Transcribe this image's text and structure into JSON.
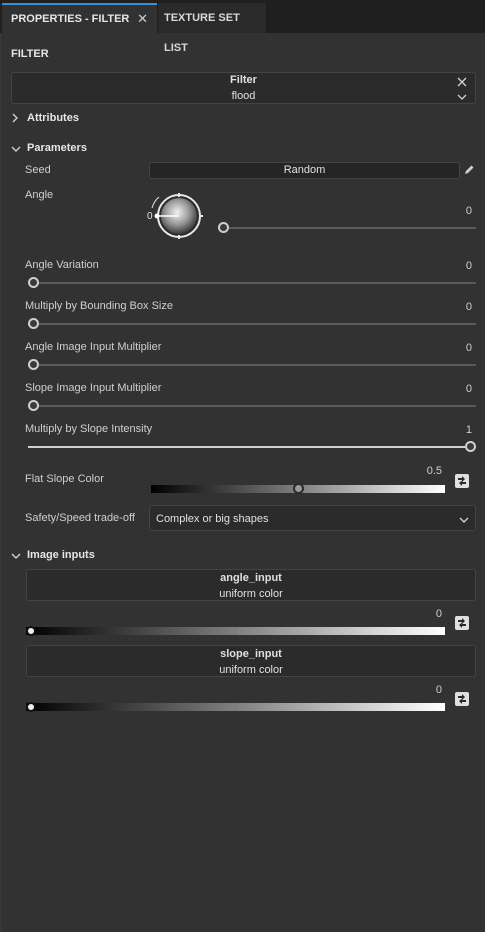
{
  "tabs": {
    "properties_label": "PROPERTIES - FILTER",
    "properties_close": "✕",
    "texture_set_label": "TEXTURE SET LIST"
  },
  "panel": {
    "section_title": "FILTER",
    "filter_header": "Filter",
    "filter_value": "flood"
  },
  "groups": {
    "attributes": "Attributes",
    "parameters": "Parameters",
    "image_inputs": "Image inputs"
  },
  "params": {
    "seed_label": "Seed",
    "seed_button": "Random",
    "angle_label": "Angle",
    "angle_dial_value": "0",
    "angle_value": "0",
    "angle_variation_label": "Angle Variation",
    "angle_variation_value": "0",
    "multiply_bbox_label": "Multiply by Bounding Box Size",
    "multiply_bbox_value": "0",
    "angle_image_mult_label": "Angle Image Input Multiplier",
    "angle_image_mult_value": "0",
    "slope_image_mult_label": "Slope Image Input Multiplier",
    "slope_image_mult_value": "0",
    "multiply_slope_label": "Multiply by Slope Intensity",
    "multiply_slope_value": "1",
    "flat_slope_label": "Flat Slope Color",
    "flat_slope_value": "0.5",
    "safety_label": "Safety/Speed trade-off",
    "safety_selected": "Complex or big shapes"
  },
  "image_inputs": {
    "angle_input_name": "angle_input",
    "angle_input_type": "uniform color",
    "angle_input_value": "0",
    "slope_input_name": "slope_input",
    "slope_input_type": "uniform color",
    "slope_input_value": "0"
  },
  "levels": {
    "angle": 0,
    "angle_variation": 0,
    "multiply_bbox": 0,
    "angle_image_mult": 0,
    "slope_image_mult": 0,
    "multiply_slope": 1,
    "flat_slope": 0.5,
    "angle_input": 0,
    "slope_input": 0
  },
  "colors": {
    "accent": "#3b8fd6",
    "background": "#323232",
    "field": "#2b2b2b"
  },
  "icons": {
    "close": "close-icon",
    "chevron_down": "chevron-down-icon",
    "chevron_right": "chevron-right-icon",
    "pencil": "pencil-icon",
    "swap": "swap-icon"
  }
}
